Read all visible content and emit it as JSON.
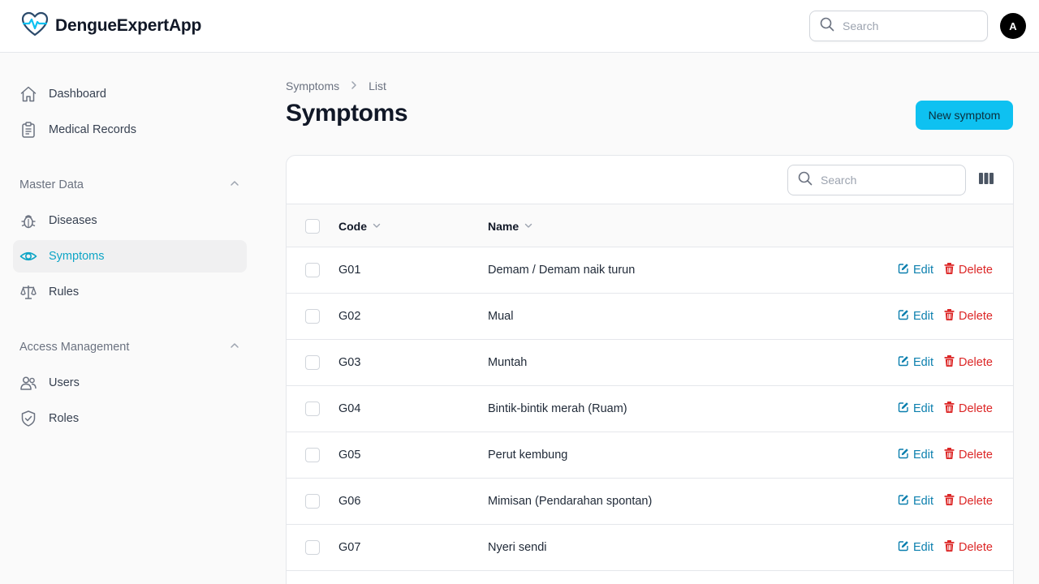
{
  "app": {
    "name": "DengueExpertApp"
  },
  "header": {
    "search_placeholder": "Search",
    "avatar_initial": "A"
  },
  "sidebar": {
    "top_items": [
      {
        "label": "Dashboard",
        "icon": "home-icon"
      },
      {
        "label": "Medical Records",
        "icon": "clipboard-icon"
      }
    ],
    "groups": [
      {
        "label": "Master Data",
        "items": [
          {
            "label": "Diseases",
            "icon": "bug-icon"
          },
          {
            "label": "Symptoms",
            "icon": "eye-icon",
            "active": true
          },
          {
            "label": "Rules",
            "icon": "scale-icon"
          }
        ]
      },
      {
        "label": "Access Management",
        "items": [
          {
            "label": "Users",
            "icon": "users-icon"
          },
          {
            "label": "Roles",
            "icon": "shield-check-icon"
          }
        ]
      }
    ]
  },
  "breadcrumb": {
    "parent": "Symptoms",
    "current": "List"
  },
  "page": {
    "title": "Symptoms",
    "new_button": "New symptom"
  },
  "table": {
    "search_placeholder": "Search",
    "columns": {
      "code": "Code",
      "name": "Name"
    },
    "edit_label": "Edit",
    "delete_label": "Delete",
    "rows": [
      {
        "code": "G01",
        "name": "Demam / Demam naik turun"
      },
      {
        "code": "G02",
        "name": "Mual"
      },
      {
        "code": "G03",
        "name": "Muntah"
      },
      {
        "code": "G04",
        "name": "Bintik-bintik merah (Ruam)"
      },
      {
        "code": "G05",
        "name": "Perut kembung"
      },
      {
        "code": "G06",
        "name": "Mimisan (Pendarahan spontan)"
      },
      {
        "code": "G07",
        "name": "Nyeri sendi"
      }
    ]
  },
  "colors": {
    "accent": "#0ec1f1",
    "active_text": "#0ea5c6",
    "edit": "#0b7fae",
    "delete": "#dc2626"
  }
}
